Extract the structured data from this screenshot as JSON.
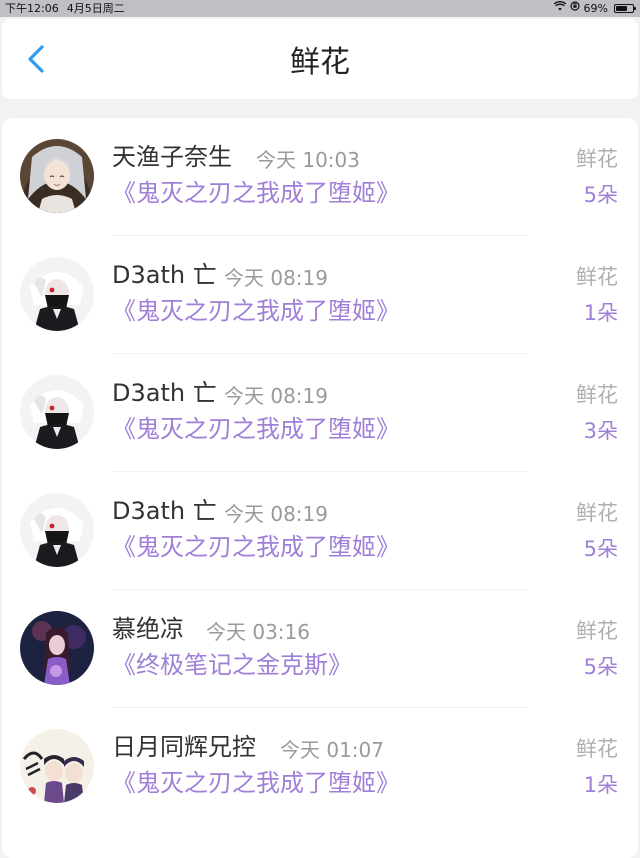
{
  "status_bar": {
    "time": "下午12:06",
    "date": "4月5日周二",
    "battery_percent": "69%",
    "battery_level": 0.69
  },
  "header": {
    "title": "鲜花"
  },
  "records": [
    {
      "name": "天渔子奈生",
      "time": "今天 10:03",
      "book": "《鬼灭之刃之我成了堕姬》",
      "gift": "鲜花",
      "count": "5朵"
    },
    {
      "name": "D3ath 亡",
      "time": "今天 08:19",
      "book": "《鬼灭之刃之我成了堕姬》",
      "gift": "鲜花",
      "count": "1朵"
    },
    {
      "name": "D3ath 亡",
      "time": "今天 08:19",
      "book": "《鬼灭之刃之我成了堕姬》",
      "gift": "鲜花",
      "count": "3朵"
    },
    {
      "name": "D3ath 亡",
      "time": "今天 08:19",
      "book": "《鬼灭之刃之我成了堕姬》",
      "gift": "鲜花",
      "count": "5朵"
    },
    {
      "name": "慕绝凉",
      "time": "今天 03:16",
      "book": "《终极笔记之金克斯》",
      "gift": "鲜花",
      "count": "5朵"
    },
    {
      "name": "日月同辉兄控",
      "time": "今天 01:07",
      "book": "《鬼灭之刃之我成了堕姬》",
      "gift": "鲜花",
      "count": "1朵"
    }
  ],
  "colors": {
    "accent": "#2d9cf0",
    "book_title": "#a07fd8",
    "muted": "#b0b0b0"
  }
}
